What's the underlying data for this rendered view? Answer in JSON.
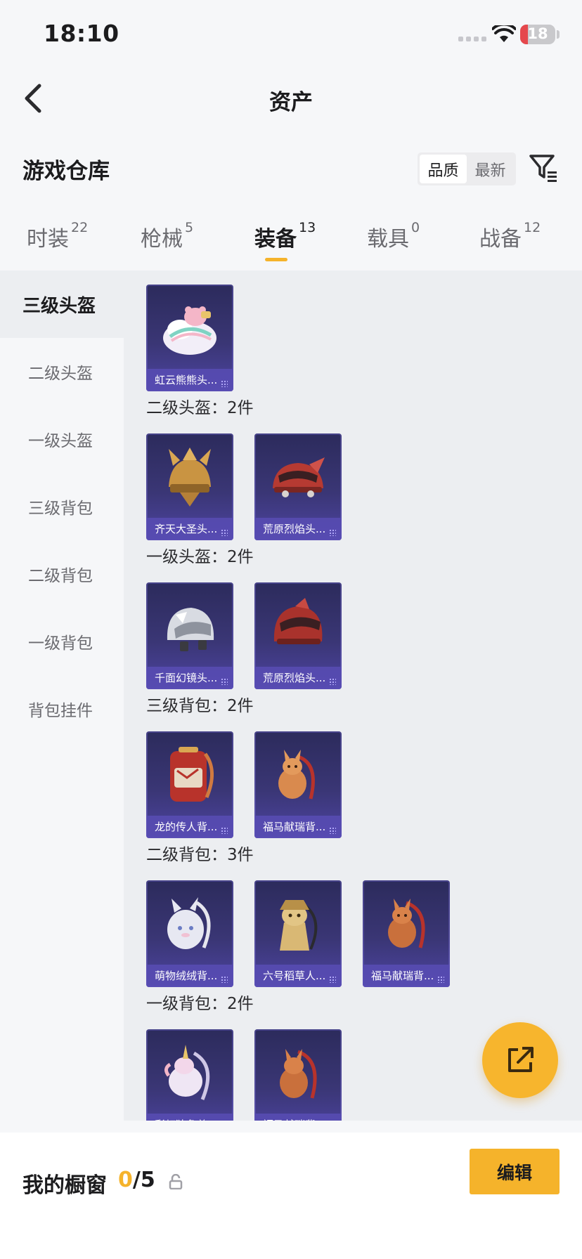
{
  "status_bar": {
    "time": "18:10",
    "battery": "18"
  },
  "nav": {
    "title": "资产"
  },
  "section": {
    "title": "游戏仓库"
  },
  "sort": {
    "options": [
      "品质",
      "最新"
    ],
    "selected": "品质"
  },
  "tabs": [
    {
      "label": "时装",
      "count": "22"
    },
    {
      "label": "枪械",
      "count": "5"
    },
    {
      "label": "装备",
      "count": "13",
      "active": true
    },
    {
      "label": "载具",
      "count": "0"
    },
    {
      "label": "战备",
      "count": "12"
    }
  ],
  "sidebar": {
    "items": [
      {
        "label": "三级头盔",
        "active": true
      },
      {
        "label": "二级头盔"
      },
      {
        "label": "一级头盔"
      },
      {
        "label": "三级背包"
      },
      {
        "label": "二级背包"
      },
      {
        "label": "一级背包"
      },
      {
        "label": "背包挂件"
      }
    ]
  },
  "groups": [
    {
      "label": "",
      "items": [
        {
          "name": "虹云熊熊头...",
          "icon": "cloud-bear-helmet-icon"
        }
      ]
    },
    {
      "label": "二级头盔：2件",
      "items": [
        {
          "name": "齐天大圣头...",
          "icon": "monkey-king-helmet-icon"
        },
        {
          "name": "荒原烈焰头...",
          "icon": "red-flame-helmet-icon"
        }
      ]
    },
    {
      "label": "一级头盔：2件",
      "items": [
        {
          "name": "千面幻镜头...",
          "icon": "mirror-helmet-icon"
        },
        {
          "name": "荒原烈焰头...",
          "icon": "red-flame-helmet-icon"
        }
      ]
    },
    {
      "label": "三级背包：2件",
      "items": [
        {
          "name": "龙的传人背...",
          "icon": "dragon-backpack-icon"
        },
        {
          "name": "福马献瑞背...",
          "icon": "horse-backpack-icon"
        }
      ]
    },
    {
      "label": "二级背包：3件",
      "items": [
        {
          "name": "萌物绒绒背...",
          "icon": "plush-backpack-icon"
        },
        {
          "name": "六号稻草人...",
          "icon": "scarecrow-backpack-icon"
        },
        {
          "name": "福马献瑞背...",
          "icon": "horse-backpack-icon"
        }
      ]
    },
    {
      "label": "一级背包：2件",
      "items": [
        {
          "name": "彩虹独角兽...",
          "icon": "unicorn-backpack-icon"
        },
        {
          "name": "福马献瑞背...",
          "icon": "horse-backpack-icon"
        }
      ]
    }
  ],
  "bottom": {
    "title": "我的橱窗",
    "showcase_used": "0",
    "showcase_total": "/5",
    "edit_label": "编辑"
  },
  "colors": {
    "accent": "#f5b32b",
    "card_bg": "#3a3675",
    "card_caption": "#584cb4",
    "content_bg": "#eceef1"
  }
}
